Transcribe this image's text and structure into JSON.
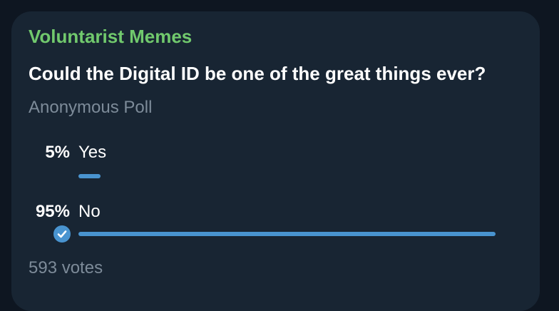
{
  "message": {
    "channel_name": "Voluntarist Memes",
    "accent_color": "#71c96d"
  },
  "poll": {
    "question": "Could the Digital ID be one of the great things ever?",
    "type_label": "Anonymous Poll",
    "bar_color": "#4994d0",
    "options": [
      {
        "label": "Yes",
        "percent_label": "5%",
        "share": 0.05,
        "voted": false
      },
      {
        "label": "No",
        "percent_label": "95%",
        "share": 0.95,
        "voted": true
      }
    ],
    "votes_label": "593 votes"
  }
}
